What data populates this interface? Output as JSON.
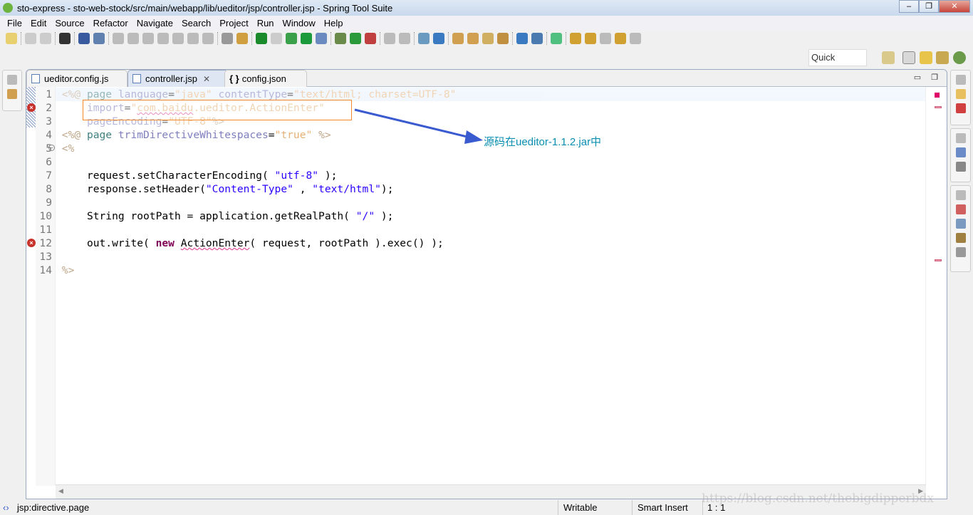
{
  "window": {
    "title": "sto-express - sto-web-stock/src/main/webapp/lib/ueditor/jsp/controller.jsp - Spring Tool Suite"
  },
  "menu": [
    "File",
    "Edit",
    "Source",
    "Refactor",
    "Navigate",
    "Search",
    "Project",
    "Run",
    "Window",
    "Help"
  ],
  "quick_access": "Quick Access",
  "tabs": [
    {
      "label": "ueditor.config.js",
      "icon": "js-file-icon"
    },
    {
      "label": "controller.jsp",
      "icon": "jsp-file-icon",
      "active": true,
      "close": "✕"
    },
    {
      "label": "config.json",
      "icon": "json-braces-icon",
      "icon_text": "{ }"
    }
  ],
  "code": {
    "line_numbers": [
      "1",
      "2",
      "3",
      "4",
      "5",
      "6",
      "7",
      "8",
      "9",
      "10",
      "11",
      "12",
      "13",
      "14"
    ],
    "errors_on_lines": [
      2,
      12
    ],
    "lines": [
      [
        [
          "<%@ ",
          "d"
        ],
        [
          "page ",
          "k"
        ],
        [
          "language",
          "a"
        ],
        [
          "=",
          "p"
        ],
        [
          "\"java\" ",
          "v"
        ],
        [
          "contentType",
          "a"
        ],
        [
          "=",
          "p"
        ],
        [
          "\"text/html; charset=UTF-8\"",
          "v"
        ]
      ],
      [
        [
          "    ",
          "p"
        ],
        [
          "import",
          "a"
        ],
        [
          "=",
          "p"
        ],
        [
          "\"",
          "v"
        ],
        [
          "com.baidu",
          "v sq"
        ],
        [
          ".ueditor.ActionEnter\"",
          "v"
        ]
      ],
      [
        [
          "    ",
          "p"
        ],
        [
          "pageEncoding",
          "a"
        ],
        [
          "=",
          "p"
        ],
        [
          "\"UTF-8\"",
          "v"
        ],
        [
          "%>",
          "d"
        ]
      ],
      [
        [
          "<%@ ",
          "d"
        ],
        [
          "page ",
          "k"
        ],
        [
          "trimDirectiveWhitespaces",
          "a"
        ],
        [
          "=",
          "p"
        ],
        [
          "\"true\" ",
          "v"
        ],
        [
          "%>",
          "d"
        ]
      ],
      [
        [
          "<%",
          "d"
        ]
      ],
      [],
      [
        [
          "    request.setCharacterEncoding( ",
          "p"
        ],
        [
          "\"utf-8\"",
          "s"
        ],
        [
          " );",
          "p"
        ]
      ],
      [
        [
          "    response.setHeader(",
          "p"
        ],
        [
          "\"Content-Type\"",
          "s"
        ],
        [
          " , ",
          "p"
        ],
        [
          "\"text/html\"",
          "s"
        ],
        [
          ");",
          "p"
        ]
      ],
      [],
      [
        [
          "    String rootPath = application.getRealPath( ",
          "p"
        ],
        [
          "\"/\"",
          "s"
        ],
        [
          " );",
          "p"
        ]
      ],
      [],
      [
        [
          "    out.write( ",
          "p"
        ],
        [
          "new",
          "kw"
        ],
        [
          " ",
          "p"
        ],
        [
          "ActionEnter",
          "p sq"
        ],
        [
          "( request, rootPath ).exec() );",
          "p"
        ]
      ],
      [],
      [
        [
          "%>",
          "d"
        ]
      ]
    ]
  },
  "annotation": "源码在ueditor-1.1.2.jar中",
  "annotation_color": "#0a8eb0",
  "status": {
    "breadcrumb": "jsp:directive.page",
    "writable": "Writable",
    "insert_mode": "Smart Insert",
    "position": "1 : 1"
  },
  "watermark": "https://blog.csdn.net/thebigdipperbdx"
}
